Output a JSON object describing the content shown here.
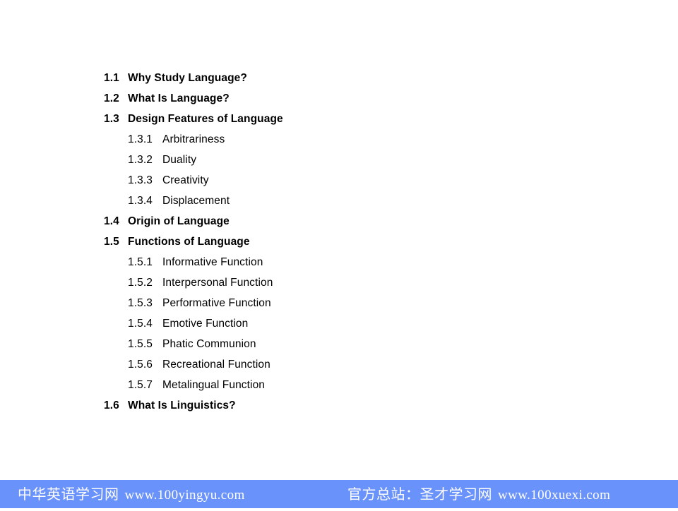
{
  "slide": {
    "background_color": "#ffffff",
    "text_color": "#000000"
  },
  "toc": {
    "items": [
      {
        "level": 1,
        "number": "1.1",
        "label": "Why Study Language?"
      },
      {
        "level": 1,
        "number": "1.2",
        "label": "What Is Language?"
      },
      {
        "level": 1,
        "number": "1.3",
        "label": "Design Features of Language"
      },
      {
        "level": 2,
        "number": "1.3.1",
        "label": "Arbitrariness"
      },
      {
        "level": 2,
        "number": "1.3.2",
        "label": "Duality"
      },
      {
        "level": 2,
        "number": "1.3.3",
        "label": "Creativity"
      },
      {
        "level": 2,
        "number": "1.3.4",
        "label": "Displacement"
      },
      {
        "level": 1,
        "number": "1.4",
        "label": "Origin of Language"
      },
      {
        "level": 1,
        "number": "1.5",
        "label": "Functions of Language"
      },
      {
        "level": 2,
        "number": "1.5.1",
        "label": "Informative Function"
      },
      {
        "level": 2,
        "number": "1.5.2",
        "label": "Interpersonal Function"
      },
      {
        "level": 2,
        "number": "1.5.3",
        "label": "Performative Function"
      },
      {
        "level": 2,
        "number": "1.5.4",
        "label": "Emotive Function"
      },
      {
        "level": 2,
        "number": "1.5.5",
        "label": "Phatic Communion"
      },
      {
        "level": 2,
        "number": "1.5.6",
        "label": "Recreational Function"
      },
      {
        "level": 2,
        "number": "1.5.7",
        "label": "Metalingual Function"
      },
      {
        "level": 1,
        "number": "1.6",
        "label": "What Is Linguistics?"
      }
    ]
  },
  "footer": {
    "background_color": "#6a92fb",
    "text_color": "#ffffff",
    "left": {
      "site_name": "中华英语学习网",
      "url": "www.100yingyu.com"
    },
    "right": {
      "site_name": "官方总站：圣才学习网",
      "url": "www.100xuexi.com"
    }
  }
}
